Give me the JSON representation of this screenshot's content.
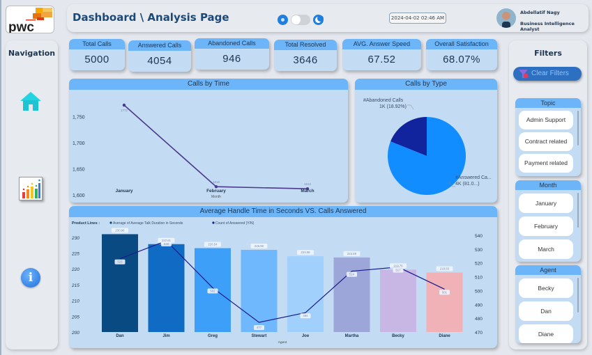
{
  "header": {
    "logo_text": "pwc",
    "title": "Dashboard \\ Analysis Page",
    "datetime": "2024-04-02 02:46 AM",
    "user_name": "Abdellatif Nagy",
    "user_role": "Business Intelligence Analyst",
    "theme_toggle": {
      "state": "light"
    }
  },
  "navigation": {
    "title": "Navigation",
    "items": [
      {
        "icon": "home-icon"
      },
      {
        "icon": "bar-chart-icon"
      },
      {
        "icon": "info-icon",
        "glyph": "i"
      }
    ]
  },
  "kpis": [
    {
      "label": "Total Calls",
      "value": "5000"
    },
    {
      "label": "Answered Calls",
      "value": "4054"
    },
    {
      "label": "Abandoned Calls",
      "value": "946"
    },
    {
      "label": "Total Resolved",
      "value": "3646"
    },
    {
      "label": "AVG. Answer Speed",
      "value": "67.52"
    },
    {
      "label": "Overall Satisfaction",
      "value": "68.07%"
    }
  ],
  "filters": {
    "title": "Filters",
    "clear_label": "Clear Filters",
    "slicers": [
      {
        "title": "Topic",
        "items": [
          "Admin Support",
          "Contract related",
          "Payment related"
        ]
      },
      {
        "title": "Month",
        "items": [
          "January",
          "February",
          "March"
        ]
      },
      {
        "title": "Agent",
        "items": [
          "Becky",
          "Dan",
          "Diane"
        ]
      }
    ]
  },
  "colors": {
    "accent": "#6cb5f9",
    "card_bg": "#c3dbf3",
    "text_dark": "#1d3550",
    "line_purple": "#4b3a8c",
    "pie_answered": "#118dff",
    "pie_abandoned": "#12239e",
    "aht_line": "#1a1a8c",
    "bar_colors": [
      "#0a4a82",
      "#0f6bc4",
      "#3d9ff8",
      "#6fb8fd",
      "#a2d0fd",
      "#9da6d8",
      "#c8b7e4",
      "#f0b2b6"
    ]
  },
  "chart_data": [
    {
      "type": "line",
      "title": "Calls by Time",
      "xlabel": "Month",
      "ylabel": "",
      "categories": [
        "January",
        "February",
        "March"
      ],
      "values": [
        1772,
        1616,
        1612
      ],
      "data_labels": [
        "1772",
        "1616",
        "1612"
      ],
      "yticks": [
        1600,
        1650,
        1700,
        1750
      ],
      "ytick_labels": [
        "1,600",
        "1,650",
        "1,700",
        "1,750"
      ],
      "ylim": [
        1595,
        1780
      ],
      "grid": false
    },
    {
      "type": "pie",
      "title": "Calls by Type",
      "slices": [
        {
          "name": "#Answered Calls",
          "value": 4054,
          "percent": 81.08,
          "label_line1": "#Answered Ca...",
          "label_line2": "4K (81.0...)"
        },
        {
          "name": "#Abandoned Calls",
          "value": 946,
          "percent": 18.92,
          "label_line1": "#Abandoned Calls",
          "label_line2": "1K (18.92%)"
        }
      ]
    },
    {
      "type": "bar",
      "title": "Average Handle Time in Seconds VS. Calls Answered",
      "legend_title": "Product Lines :",
      "legend": [
        "Average of Average Talk Duration in Seconds",
        "Count of Answered (Y/N)"
      ],
      "legend_placement": "top-left",
      "xlabel": "Agent",
      "categories": [
        "Dan",
        "Jim",
        "Greg",
        "Stewart",
        "Joe",
        "Martha",
        "Becky",
        "Diane"
      ],
      "series": [
        {
          "name": "Average of Average Talk Duration in Seconds",
          "type": "bar",
          "axis": "left",
          "values": [
            230.96,
            227.81,
            226.54,
            226.0,
            223.98,
            223.59,
            219.75,
            218.83
          ],
          "labels": [
            "230.96",
            "227.81",
            "226.54",
            "226.00",
            "223.98",
            "223.59",
            "219.75",
            "218.83"
          ]
        },
        {
          "name": "Count of Answered (Y/N)",
          "type": "line",
          "axis": "right",
          "values": [
            523,
            536,
            502,
            477,
            484,
            514,
            517,
            501
          ],
          "labels": [
            "523",
            "536",
            "502",
            "477",
            "484",
            "514",
            "517",
            "501"
          ]
        }
      ],
      "y_left": {
        "ticks": [
          200,
          205,
          210,
          215,
          220,
          225,
          230
        ],
        "lim": [
          200,
          231.5
        ]
      },
      "y_right": {
        "ticks": [
          470,
          480,
          490,
          500,
          510,
          520,
          530,
          540
        ],
        "lim": [
          470,
          542
        ]
      }
    }
  ]
}
